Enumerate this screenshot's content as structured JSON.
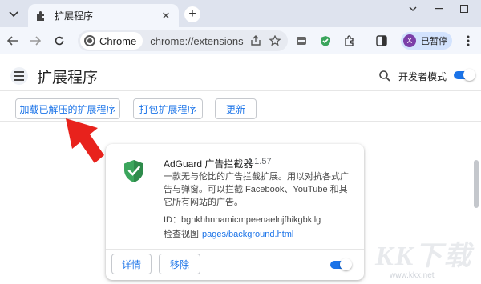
{
  "browser": {
    "tab_title": "扩展程序",
    "address_chip": "Chrome",
    "address_url": "chrome://extensions",
    "profile_initial": "X",
    "profile_label": "已暂停"
  },
  "header": {
    "title": "扩展程序",
    "dev_mode_label": "开发者模式",
    "dev_mode_on": true
  },
  "actions": {
    "load_unpacked": "加载已解压的扩展程序",
    "pack": "打包扩展程序",
    "update": "更新"
  },
  "extension": {
    "name": "AdGuard 广告拦截器",
    "version": "4.1.57",
    "description": "一款无与伦比的广告拦截扩展。用以对抗各式广告与弹窗。可以拦截 Facebook、YouTube 和其它所有网站的广告。",
    "id_line": "ID：bgnkhhnnamicmpeenaelnjfhikgbkllg",
    "views_label": "检查视图",
    "views_link": "pages/background.html",
    "details_button": "详情",
    "remove_button": "移除",
    "enabled": true
  },
  "watermark": {
    "text": "KK下载",
    "url": "www.kkx.net"
  },
  "colors": {
    "accent": "#1a73e8",
    "shield_green": "#3ba55c",
    "arrow_red": "#e8221c"
  },
  "icons": [
    "puzzle-icon",
    "chrome-logo-icon",
    "share-icon",
    "star-icon",
    "adguard-shield-icon",
    "extensions-icon",
    "sidepanel-icon",
    "more-icon",
    "search-icon"
  ]
}
